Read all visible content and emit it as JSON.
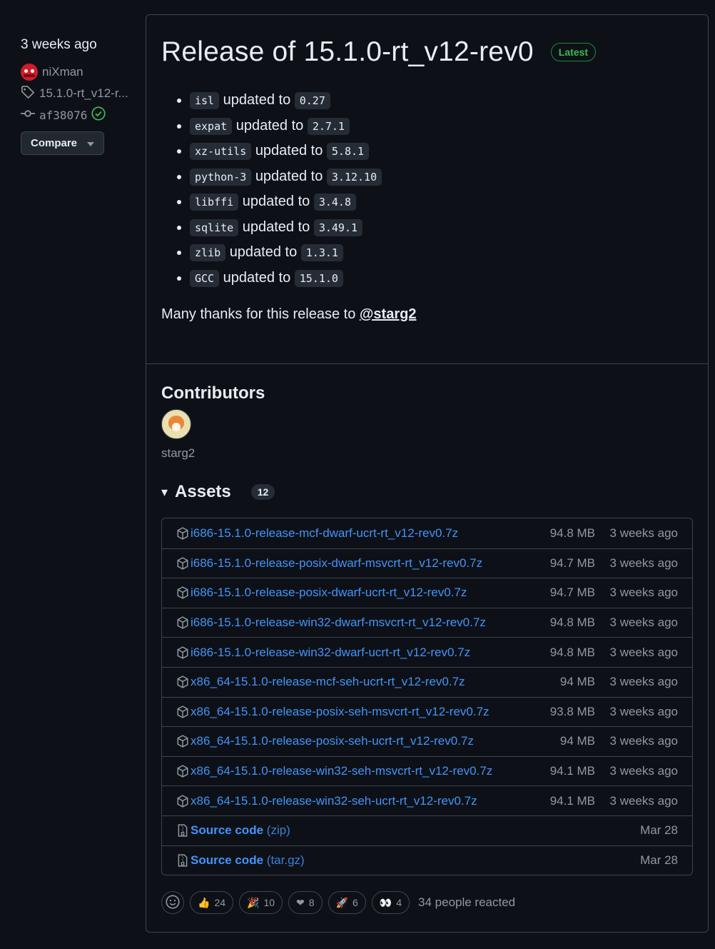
{
  "sidebar": {
    "date": "3 weeks ago",
    "author": "niXman",
    "tag": "15.1.0-rt_v12-r...",
    "commit": "af38076",
    "compare_label": "Compare"
  },
  "release": {
    "title": "Release of 15.1.0-rt_v12-rev0",
    "badge": "Latest",
    "changes": [
      {
        "pkg": "isl",
        "text": "updated to",
        "ver": "0.27"
      },
      {
        "pkg": "expat",
        "text": "updated to",
        "ver": "2.7.1"
      },
      {
        "pkg": "xz-utils",
        "text": "updated to",
        "ver": "5.8.1"
      },
      {
        "pkg": "python-3",
        "text": "updated to",
        "ver": "3.12.10"
      },
      {
        "pkg": "libffi",
        "text": "updated to",
        "ver": "3.4.8"
      },
      {
        "pkg": "sqlite",
        "text": "updated to",
        "ver": "3.49.1"
      },
      {
        "pkg": "zlib",
        "text": "updated to",
        "ver": "1.3.1"
      },
      {
        "pkg": "GCC",
        "text": "updated to",
        "ver": "15.1.0"
      }
    ],
    "thanks_text": "Many thanks for this release to ",
    "thanks_user": "@starg2"
  },
  "contributors": {
    "heading": "Contributors",
    "names": [
      "starg2"
    ]
  },
  "assets": {
    "heading": "Assets",
    "count": "12",
    "files": [
      {
        "name": "i686-15.1.0-release-mcf-dwarf-ucrt-rt_v12-rev0.7z",
        "size": "94.8 MB",
        "date": "3 weeks ago"
      },
      {
        "name": "i686-15.1.0-release-posix-dwarf-msvcrt-rt_v12-rev0.7z",
        "size": "94.7 MB",
        "date": "3 weeks ago"
      },
      {
        "name": "i686-15.1.0-release-posix-dwarf-ucrt-rt_v12-rev0.7z",
        "size": "94.7 MB",
        "date": "3 weeks ago"
      },
      {
        "name": "i686-15.1.0-release-win32-dwarf-msvcrt-rt_v12-rev0.7z",
        "size": "94.8 MB",
        "date": "3 weeks ago"
      },
      {
        "name": "i686-15.1.0-release-win32-dwarf-ucrt-rt_v12-rev0.7z",
        "size": "94.8 MB",
        "date": "3 weeks ago"
      },
      {
        "name": "x86_64-15.1.0-release-mcf-seh-ucrt-rt_v12-rev0.7z",
        "size": "94 MB",
        "date": "3 weeks ago"
      },
      {
        "name": "x86_64-15.1.0-release-posix-seh-msvcrt-rt_v12-rev0.7z",
        "size": "93.8 MB",
        "date": "3 weeks ago"
      },
      {
        "name": "x86_64-15.1.0-release-posix-seh-ucrt-rt_v12-rev0.7z",
        "size": "94 MB",
        "date": "3 weeks ago"
      },
      {
        "name": "x86_64-15.1.0-release-win32-seh-msvcrt-rt_v12-rev0.7z",
        "size": "94.1 MB",
        "date": "3 weeks ago"
      },
      {
        "name": "x86_64-15.1.0-release-win32-seh-ucrt-rt_v12-rev0.7z",
        "size": "94.1 MB",
        "date": "3 weeks ago"
      }
    ],
    "source": [
      {
        "label": "Source code",
        "fmt": "(zip)",
        "date": "Mar 28"
      },
      {
        "label": "Source code",
        "fmt": "(tar.gz)",
        "date": "Mar 28"
      }
    ]
  },
  "reactions": {
    "items": [
      {
        "icon": "thumbs-up-icon",
        "emoji": "👍",
        "count": "24"
      },
      {
        "icon": "party-popper-icon",
        "emoji": "🎉",
        "count": "10"
      },
      {
        "icon": "heart-icon",
        "emoji": "❤",
        "count": "8"
      },
      {
        "icon": "rocket-icon",
        "emoji": "🚀",
        "count": "6"
      },
      {
        "icon": "eyes-icon",
        "emoji": "👀",
        "count": "4"
      }
    ],
    "summary": "34 people reacted"
  },
  "colors": {
    "link": "#4493f8",
    "latest": "#3fb950",
    "bg": "#0d1117"
  }
}
